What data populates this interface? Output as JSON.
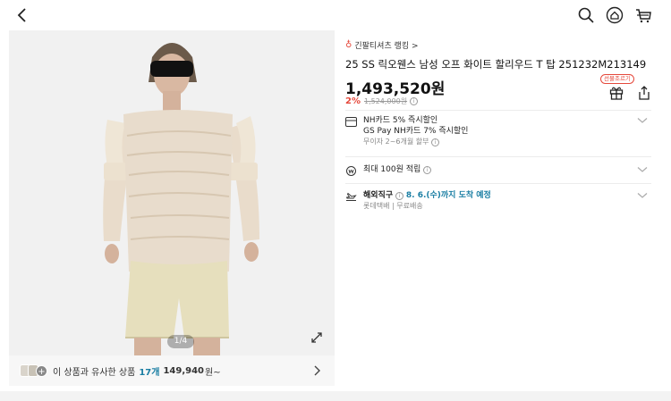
{
  "topbar": {
    "back_icon": "chevron-left-icon",
    "icons": [
      "search-icon",
      "home-icon",
      "cart-icon"
    ]
  },
  "gallery": {
    "page_indicator": "1/4",
    "expand_icon": "expand-icon"
  },
  "similar": {
    "prefix": "이 상품과 유사한 상품",
    "count": "17개",
    "price": "149,940",
    "suffix": "원~"
  },
  "product": {
    "ranking": "긴팔티셔츠 랭킹 >",
    "title": "25 SS 릭오웬스 남성 오프 화이트 할리우드 T 탑 251232M213149",
    "price": "1,493,520원",
    "discount": "2%",
    "original_price": "1,524,000원",
    "gift_badge": "선물조르기"
  },
  "card_benefit": {
    "line1": "NH카드 5% 즉시할인",
    "line2": "GS Pay NH카드 7% 즉시할인",
    "line3": "무이자 2~6개월 할부"
  },
  "points": {
    "label": "최대 100원 적립"
  },
  "shipping": {
    "label": "해외직구",
    "date": "8. 6.(수)까지 도착 예정",
    "sub1": "롯데택배",
    "sub2": "무료배송"
  },
  "colors": {
    "accent_red": "#e5483b",
    "teal": "#1a7ea3"
  }
}
